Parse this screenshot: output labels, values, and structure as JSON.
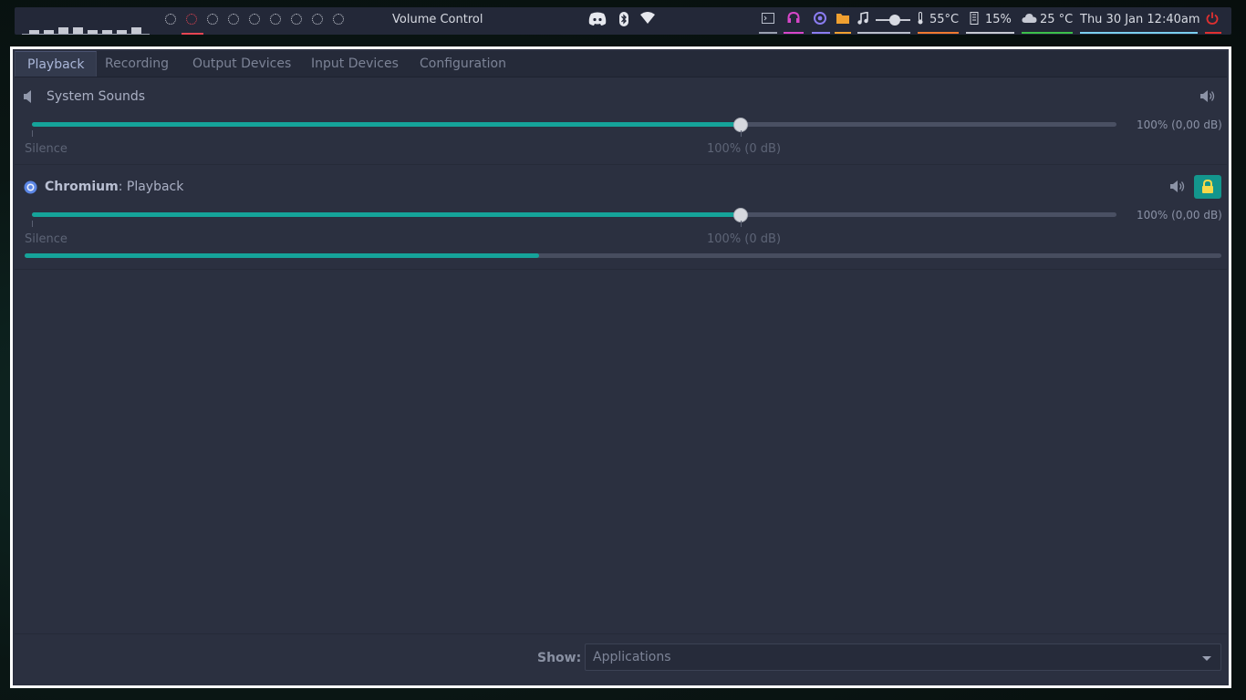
{
  "topbar": {
    "cpu_bars": [
      4,
      4,
      7,
      7,
      4,
      4,
      4,
      7
    ],
    "workspace_count": 10,
    "active_workspace": 2,
    "window_title": "Volume Control",
    "temperature": "55°C",
    "memory": "15%",
    "weather": "25 °C",
    "datetime": "Thu 30 Jan 12:40am",
    "volume_level": 0.55,
    "colors": {
      "terminal": "#9aa0b0",
      "headphones": "#d646c8",
      "chromium": "#8a7cf0",
      "files": "#f0a030",
      "music": "#b9bfd2",
      "temp": "#f07a30",
      "memory": "#c6c9d3",
      "weather": "#3cc04a",
      "datetime": "#7ad0f0",
      "power": "#e03030"
    }
  },
  "tabs": [
    {
      "label": "Playback",
      "active": true
    },
    {
      "label": "Recording",
      "active": false
    },
    {
      "label": "Output Devices",
      "active": false
    },
    {
      "label": "Input Devices",
      "active": false
    },
    {
      "label": "Configuration",
      "active": false
    }
  ],
  "streams": [
    {
      "name": "System Sounds",
      "app": "",
      "volume_percent": 100,
      "volume_label": "100% (0,00 dB)",
      "scale_min": "Silence",
      "scale_mid": "100% (0 dB)"
    },
    {
      "name": "Chromium",
      "app": ": Playback",
      "volume_percent": 100,
      "volume_label": "100% (0,00 dB)",
      "scale_min": "Silence",
      "scale_mid": "100% (0 dB)",
      "level_meter": 0.43,
      "locked": true
    }
  ],
  "bottom": {
    "show_label": "Show:",
    "show_value": "Applications"
  },
  "accent": "#15a39a"
}
